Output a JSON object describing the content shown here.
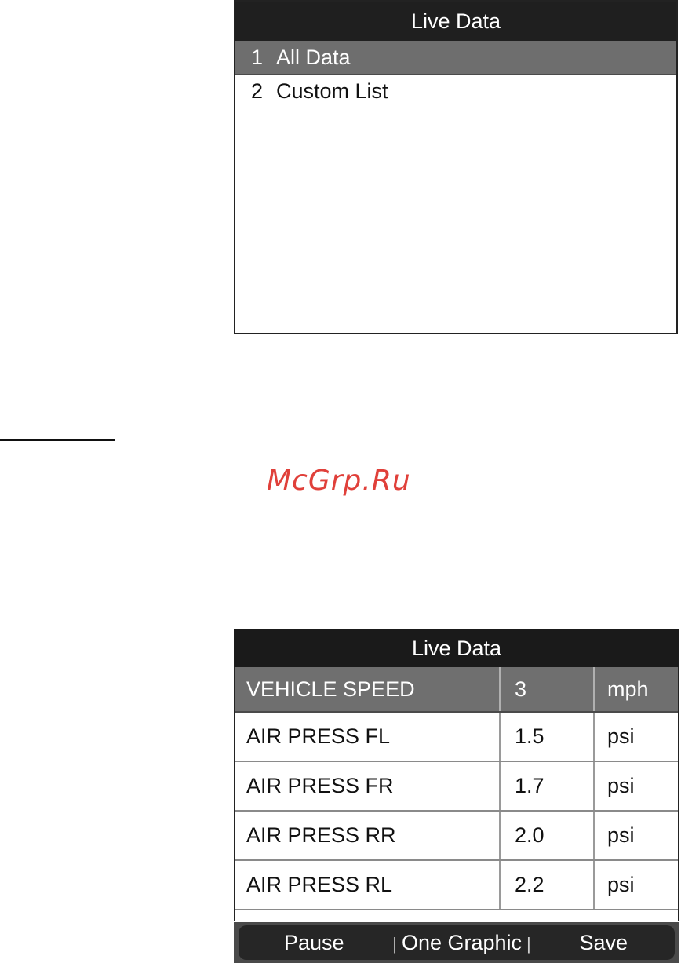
{
  "screen1": {
    "title": "Live Data",
    "menu": [
      {
        "num": "1",
        "label": "All Data",
        "selected": true
      },
      {
        "num": "2",
        "label": "Custom List",
        "selected": false
      }
    ]
  },
  "watermark": "McGrp.Ru",
  "screen2": {
    "title": "Live Data",
    "rows": [
      {
        "name": "VEHICLE SPEED",
        "value": "3",
        "unit": "mph"
      },
      {
        "name": "AIR PRESS FL",
        "value": "1.5",
        "unit": "psi"
      },
      {
        "name": "AIR PRESS FR",
        "value": "1.7",
        "unit": "psi"
      },
      {
        "name": "AIR PRESS RR",
        "value": "2.0",
        "unit": "psi"
      },
      {
        "name": "AIR PRESS RL",
        "value": "2.2",
        "unit": "psi"
      }
    ],
    "footer": {
      "pause": "Pause",
      "one_graphic": "One Graphic",
      "save": "Save",
      "separator": "|"
    }
  },
  "colors": {
    "title_bar": "#1f1f1f",
    "selected_row": "#6e6e6e",
    "watermark": "#e0403a"
  }
}
